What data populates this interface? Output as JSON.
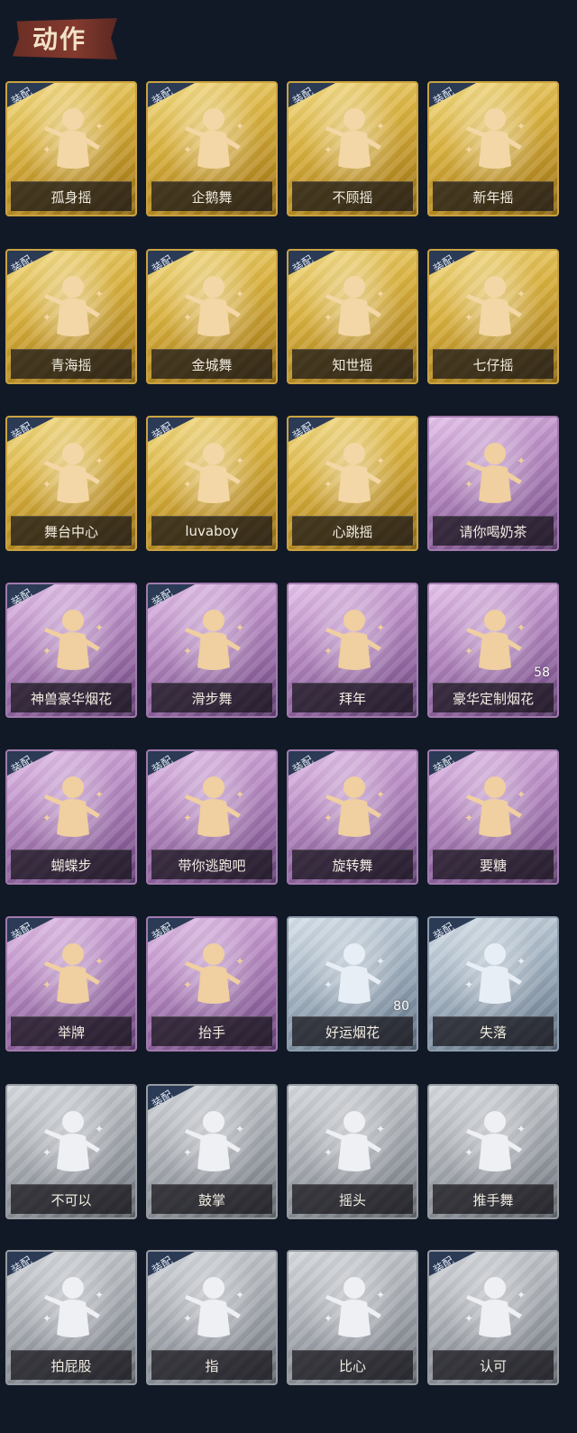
{
  "header": {
    "title": "动作"
  },
  "equipped_label": "装配",
  "colors": {
    "gold_icon": "#f4d7a6",
    "purple_icon": "#f0cfa0",
    "blue_icon": "#e8eef5",
    "gray_icon": "#eef0f4",
    "background": "#121926"
  },
  "cards": [
    {
      "label": "孤身摇",
      "tier": "gold",
      "equipped": true,
      "icon": "figure-stars-icon"
    },
    {
      "label": "企鹅舞",
      "tier": "gold",
      "equipped": true,
      "icon": "figure-dance-icon"
    },
    {
      "label": "不顾摇",
      "tier": "gold",
      "equipped": true,
      "icon": "figure-point-icon"
    },
    {
      "label": "新年摇",
      "tier": "gold",
      "equipped": true,
      "icon": "figure-music-icon"
    },
    {
      "label": "青海摇",
      "tier": "gold",
      "equipped": true,
      "icon": "figure-arms-icon"
    },
    {
      "label": "金城舞",
      "tier": "gold",
      "equipped": true,
      "icon": "figure-sparkle-icon"
    },
    {
      "label": "知世摇",
      "tier": "gold",
      "equipped": true,
      "icon": "figure-music-icon"
    },
    {
      "label": "七仔摇",
      "tier": "gold",
      "equipped": true,
      "icon": "figure-dance-icon"
    },
    {
      "label": "舞台中心",
      "tier": "gold",
      "equipped": true,
      "icon": "figure-stars-icon"
    },
    {
      "label": "luvaboy",
      "tier": "gold",
      "equipped": true,
      "icon": "figure-arms-icon"
    },
    {
      "label": "心跳摇",
      "tier": "gold",
      "equipped": true,
      "icon": "figure-wave-icon"
    },
    {
      "label": "请你喝奶茶",
      "tier": "purple",
      "equipped": false,
      "icon": "figure-sign-icon"
    },
    {
      "label": "神兽豪华烟花",
      "tier": "purple",
      "equipped": true,
      "icon": "fireworks-box-icon"
    },
    {
      "label": "滑步舞",
      "tier": "purple",
      "equipped": true,
      "icon": "figure-music-icon"
    },
    {
      "label": "拜年",
      "tier": "purple",
      "equipped": false,
      "icon": "figure-bow-icon"
    },
    {
      "label": "豪华定制烟花",
      "tier": "purple",
      "equipped": false,
      "icon": "fireworks-gift-icon",
      "count": "58"
    },
    {
      "label": "蝴蝶步",
      "tier": "purple",
      "equipped": true,
      "icon": "figure-arms-icon"
    },
    {
      "label": "带你逃跑吧",
      "tier": "purple",
      "equipped": true,
      "icon": "figure-point-icon"
    },
    {
      "label": "旋转舞",
      "tier": "purple",
      "equipped": true,
      "icon": "figure-spin-icon"
    },
    {
      "label": "要糖",
      "tier": "purple",
      "equipped": true,
      "icon": "figure-ask-icon"
    },
    {
      "label": "举牌",
      "tier": "purple",
      "equipped": true,
      "icon": "figure-sign-icon"
    },
    {
      "label": "抬手",
      "tier": "purple",
      "equipped": true,
      "icon": "figure-raise-icon"
    },
    {
      "label": "好运烟花",
      "tier": "blue",
      "equipped": false,
      "icon": "firework-can-icon",
      "count": "80"
    },
    {
      "label": "失落",
      "tier": "blue",
      "equipped": true,
      "icon": "figure-crawl-icon"
    },
    {
      "label": "不可以",
      "tier": "gray",
      "equipped": false,
      "icon": "finger-wag-icon"
    },
    {
      "label": "鼓掌",
      "tier": "gray",
      "equipped": true,
      "icon": "hands-clap-icon"
    },
    {
      "label": "摇头",
      "tier": "gray",
      "equipped": false,
      "icon": "figure-shake-icon"
    },
    {
      "label": "推手舞",
      "tier": "gray",
      "equipped": false,
      "icon": "figure-push-icon"
    },
    {
      "label": "拍屁股",
      "tier": "gray",
      "equipped": true,
      "icon": "figure-bend-icon"
    },
    {
      "label": "指",
      "tier": "gray",
      "equipped": true,
      "icon": "hand-point-icon"
    },
    {
      "label": "比心",
      "tier": "gray",
      "equipped": false,
      "icon": "heart-hand-icon"
    },
    {
      "label": "认可",
      "tier": "gray",
      "equipped": true,
      "icon": "thumbs-up-icon"
    }
  ]
}
